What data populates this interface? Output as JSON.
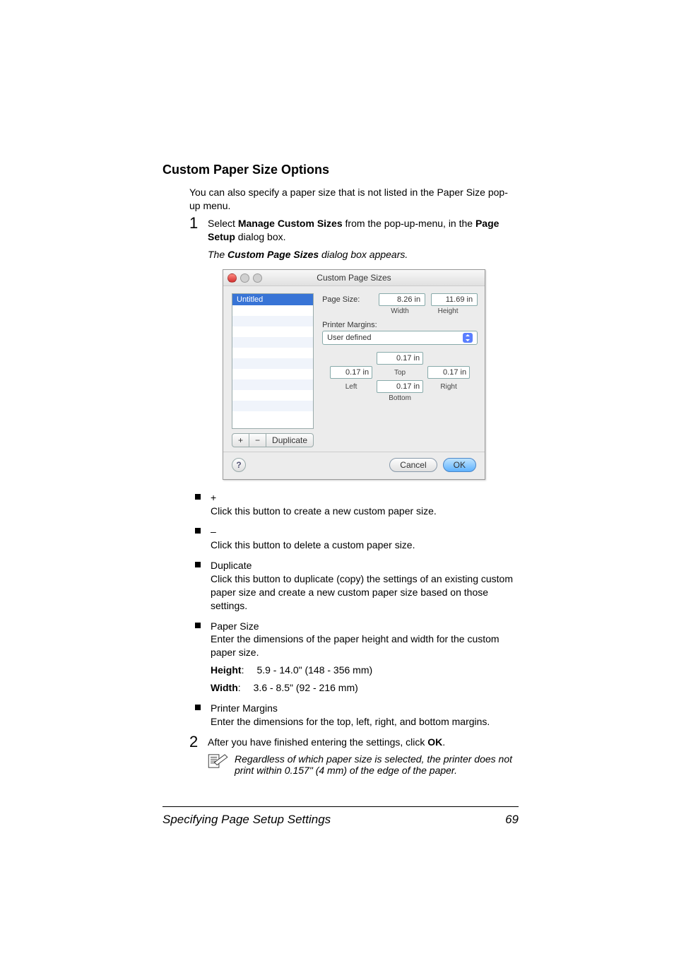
{
  "heading": "Custom Paper Size Options",
  "intro": "You can also specify a paper size that is not listed in the Paper Size pop-up menu.",
  "step1": {
    "num": "1",
    "pre": "Select ",
    "bold": "Manage Custom Sizes",
    "mid": " from the pop-up-menu, in the ",
    "bold2": "Page Setup",
    "post": " dialog box."
  },
  "caption": {
    "pre": "The ",
    "bold": "Custom Page Sizes",
    "post": " dialog box appears."
  },
  "dialog": {
    "title": "Custom Page Sizes",
    "list_selected": "Untitled",
    "btn_plus": "+",
    "btn_minus": "−",
    "btn_duplicate": "Duplicate",
    "page_size_label": "Page Size:",
    "width_val": "8.26 in",
    "width_lbl": "Width",
    "height_val": "11.69 in",
    "height_lbl": "Height",
    "printer_margins_label": "Printer Margins:",
    "margins_select": "User defined",
    "top_val": "0.17 in",
    "top_lbl": "Top",
    "left_val": "0.17 in",
    "left_lbl": "Left",
    "right_val": "0.17 in",
    "right_lbl": "Right",
    "bottom_val": "0.17 in",
    "bottom_lbl": "Bottom",
    "help": "?",
    "cancel": "Cancel",
    "ok": "OK"
  },
  "bullets": {
    "plus": {
      "title": "+",
      "desc": "Click this button to create a new custom paper size."
    },
    "minus": {
      "title": "–",
      "desc": "Click this button to delete a custom paper size."
    },
    "duplicate": {
      "title": "Duplicate",
      "desc": "Click this button to duplicate (copy) the settings of an existing custom paper size and create a new custom paper size based on those settings."
    },
    "paper_size": {
      "title": "Paper Size",
      "desc": "Enter the dimensions of the paper height and width for the custom paper size.",
      "height_label": "Height",
      "height_colon": ":",
      "height_val": "5.9 - 14.0\" (148 - 356 mm)",
      "width_label": "Width",
      "width_colon": ":",
      "width_val": "3.6 - 8.5\" (92 - 216 mm)"
    },
    "printer_margins": {
      "title": "Printer Margins",
      "desc": "Enter the dimensions for the top, left, right, and bottom margins."
    }
  },
  "step2": {
    "num": "2",
    "pre": "After you have finished entering the settings, click ",
    "bold": "OK",
    "post": "."
  },
  "note": "Regardless of which paper size is selected, the printer does not print within 0.157\" (4 mm) of the edge of the paper.",
  "footer": {
    "title": "Specifying Page Setup Settings",
    "page": "69"
  }
}
